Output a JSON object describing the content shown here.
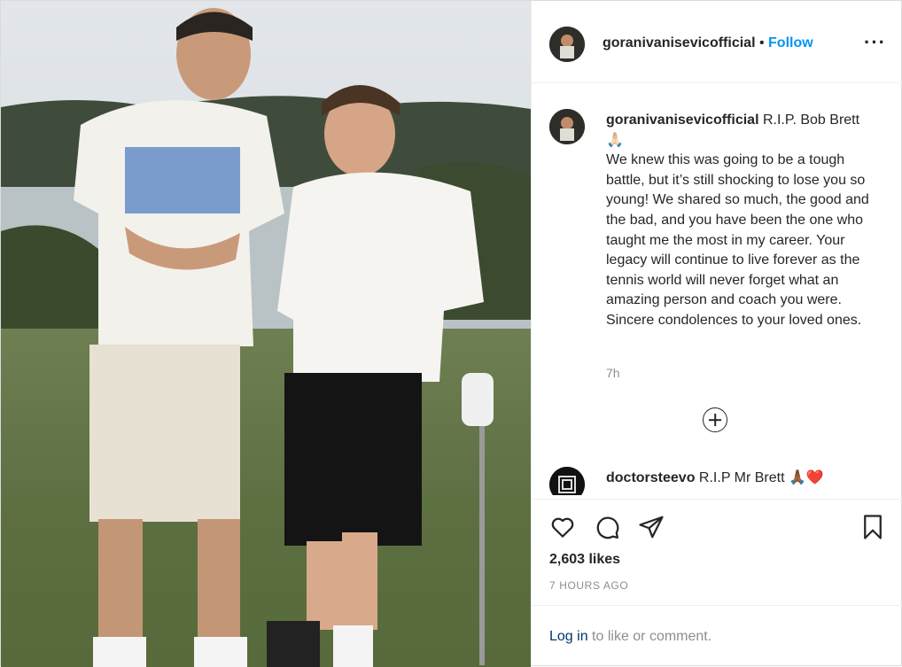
{
  "post": {
    "username": "goranivanisevicofficial",
    "separator": "•",
    "follow_label": "Follow",
    "more_icon": "more-options-icon"
  },
  "caption": {
    "username": "goranivanisevicofficial",
    "first_line": "R.I.P. Bob Brett",
    "emoji": "🙏🏻",
    "body": "We knew this was going to be a tough battle, but it’s still shocking to lose you so young! We shared so much, the good and the bad, and you have been the one who taught me the most in my career. Your legacy will continue to live forever as the tennis world will never forget what an amazing person and coach you were. Sincere condolences to your loved ones.",
    "time": "7h"
  },
  "comments": [
    {
      "username": "doctorsteevo",
      "text": "R.I.P Mr Brett",
      "emoji": "🙏🏾❤️"
    }
  ],
  "actions": {
    "likes": "2,603 likes",
    "posted_ago": "7 HOURS AGO"
  },
  "login_prompt": {
    "link": "Log in",
    "rest": " to like or comment."
  },
  "colors": {
    "accent": "#0095f6",
    "text": "#262626",
    "muted": "#8e8e8e",
    "border": "#efefef"
  }
}
